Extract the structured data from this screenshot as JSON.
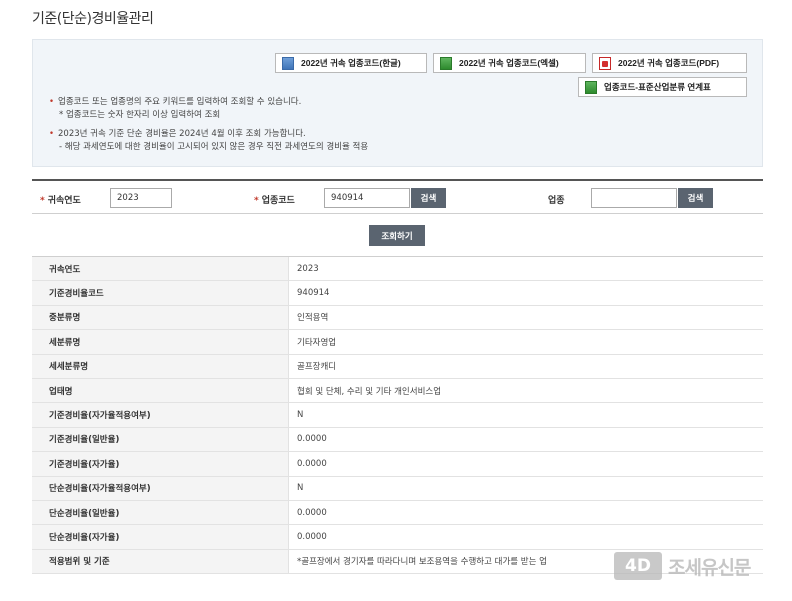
{
  "page_title": "기준(단순)경비율관리",
  "downloads": [
    {
      "label": "2022년 귀속 업종코드(한글)",
      "icon": "hwp-file-icon"
    },
    {
      "label": "2022년 귀속 업종코드(엑셀)",
      "icon": "excel-file-icon"
    },
    {
      "label": "2022년 귀속 업종코드(PDF)",
      "icon": "pdf-file-icon"
    },
    {
      "label": "업종코드-표준산업분류 연계표",
      "icon": "excel-file-icon"
    }
  ],
  "notes": {
    "line1": "업종코드 또는 업종명의 주요 키워드를 입력하여 조회할 수 있습니다.",
    "line1_sub": "* 업종코드는 숫자 한자리 이상 입력하여 조회",
    "line2": "2023년 귀속 기준 단순 경비율은 2024년 4월 이후 조회 가능합니다.",
    "line2_sub": "- 해당 과세연도에 대한 경비율이 고시되어 있지 않은 경우 직전 과세연도의 경비율 적용",
    "bullet": "•"
  },
  "search": {
    "required_mark": "*",
    "year_label": "귀속연도",
    "year_value": "2023",
    "code_label": "업종코드",
    "code_value": "940914",
    "code_search_btn": "검색",
    "industry_label": "업종",
    "industry_value": "",
    "industry_search_btn": "검색",
    "query_btn": "조회하기"
  },
  "result_rows": [
    {
      "label": "귀속연도",
      "value": "2023"
    },
    {
      "label": "기준경비율코드",
      "value": "940914"
    },
    {
      "label": "중분류명",
      "value": "인적용역"
    },
    {
      "label": "세분류명",
      "value": "기타자영업"
    },
    {
      "label": "세세분류명",
      "value": "골프장캐디"
    },
    {
      "label": "업태명",
      "value": "협회 및 단체, 수리 및 기타 개인서비스업"
    },
    {
      "label": "기준경비율(자가율적용여부)",
      "value": "N"
    },
    {
      "label": "기준경비율(일반율)",
      "value": "0.0000"
    },
    {
      "label": "기준경비율(자가율)",
      "value": "0.0000"
    },
    {
      "label": "단순경비율(자가율적용여부)",
      "value": "N"
    },
    {
      "label": "단순경비율(일반율)",
      "value": "0.0000"
    },
    {
      "label": "단순경비율(자가율)",
      "value": "0.0000"
    },
    {
      "label": "적용범위 및 기준",
      "value": "*골프장에서 경기자를 따라다니며 보조용역을 수행하고 대가를 받는 업"
    }
  ],
  "watermark": {
    "logo": "4D",
    "name": "조세유신문"
  }
}
